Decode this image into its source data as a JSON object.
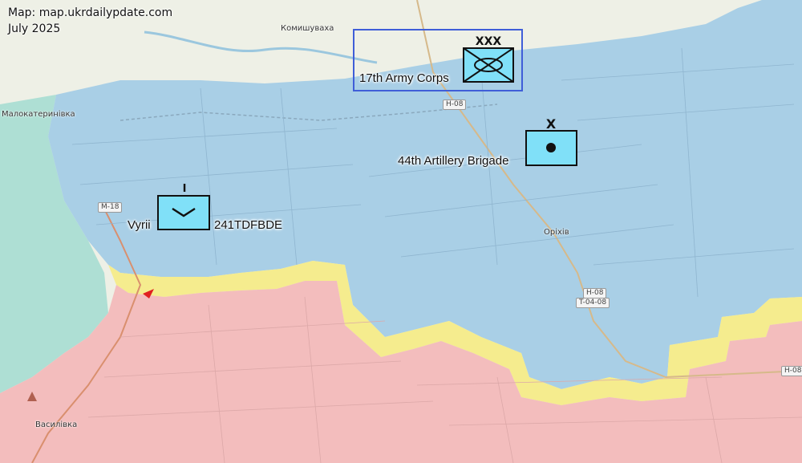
{
  "credit": {
    "source": "Map: map.ukrdailypdate.com",
    "date": "July 2025"
  },
  "places": {
    "komyshuvakha": "Комишуваха",
    "malokaterynivka": "Малокатеринівка",
    "orikhiv": "Оріхів",
    "vasylivka": "Василівка"
  },
  "roads": {
    "m18": "M-18",
    "h08_north": "H-08",
    "h08_orikhiv": "H-08",
    "t0408": "T-04-08",
    "h08_east": "H-08"
  },
  "units": {
    "corps": {
      "label": "17th Army Corps",
      "echelon": "XXX"
    },
    "artillery": {
      "label": "44th Artillery Brigade",
      "echelon": "X"
    },
    "tdf": {
      "label_left": "Vyrii",
      "label_right": "241TDFBDE",
      "echelon": "I"
    }
  },
  "colors": {
    "ukrainian_control": "#a9cfe6",
    "russian_control": "#f3bdbd",
    "contested": "#f5ec8e",
    "water": "#aadbe8",
    "unit_fill": "#80e0f8",
    "hq_box": "#3f5ed8"
  }
}
